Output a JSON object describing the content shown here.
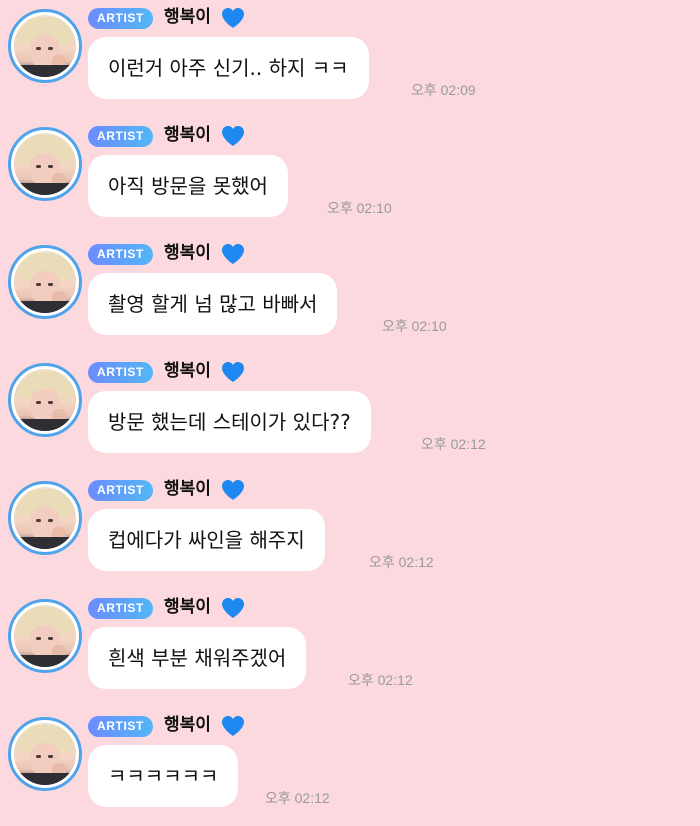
{
  "sender": {
    "badge": "ARTIST",
    "name": "행복이"
  },
  "messages": [
    {
      "text": "이런거 아주 신기.. 하지 ㅋㅋ",
      "time": "오후 02:09"
    },
    {
      "text": "아직 방문을 못했어",
      "time": "오후 02:10"
    },
    {
      "text": "촬영 할게 넘 많고 바빠서",
      "time": "오후 02:10"
    },
    {
      "text": "방문 했는데 스테이가 있다??",
      "time": "오후 02:12"
    },
    {
      "text": "컵에다가 싸인을 해주지",
      "time": "오후 02:12"
    },
    {
      "text": "흰색 부분 채워주겠어",
      "time": "오후 02:12"
    },
    {
      "text": "ㅋㅋㅋㅋㅋㅋ",
      "time": "오후 02:12"
    }
  ],
  "colors": {
    "background": "#fcd9de",
    "bubble": "#ffffff",
    "badge_gradient_start": "#6c8cff",
    "badge_gradient_end": "#53b6f7",
    "avatar_ring": "#4fa3ea",
    "heart": "#1e88f0",
    "timestamp": "#9a9a9a"
  },
  "icons": {
    "heart": "blue-heart-icon"
  }
}
